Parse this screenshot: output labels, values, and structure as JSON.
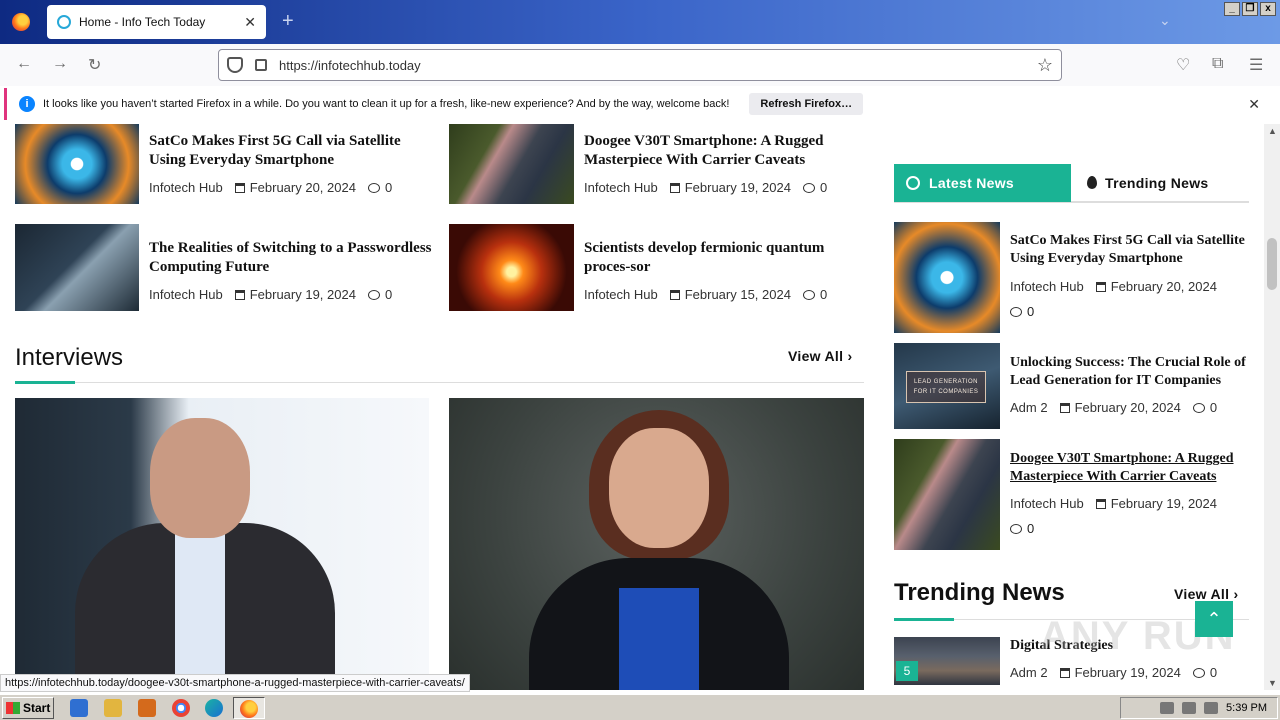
{
  "browser": {
    "tab_title": "Home - Info Tech Today",
    "url": "https://infotechhub.today",
    "notification": "It looks like you haven’t started Firefox in a while. Do you want to clean it up for a fresh, like-new experience? And by the way, welcome back!",
    "refresh_button": "Refresh Firefox…",
    "status_url": "https://infotechhub.today/doogee-v30t-smartphone-a-rugged-masterpiece-with-carrier-caveats/"
  },
  "main_cards": [
    {
      "title": "SatCo Makes First 5G Call via Satellite Using Everyday Smartphone",
      "author": "Infotech Hub",
      "date": "February 20, 2024",
      "comments": "0"
    },
    {
      "title": "Doogee V30T Smartphone: A Rugged Masterpiece With Carrier Caveats",
      "author": "Infotech Hub",
      "date": "February 19, 2024",
      "comments": "0"
    },
    {
      "title": "The Realities of Switching to a Passwordless Computing Future",
      "author": "Infotech Hub",
      "date": "February 19, 2024",
      "comments": "0"
    },
    {
      "title": "Scientists develop fermionic quantum proces-sor",
      "author": "Infotech Hub",
      "date": "February 15, 2024",
      "comments": "0"
    }
  ],
  "interviews": {
    "title": "Interviews",
    "view_all": "View All"
  },
  "sidebar": {
    "tabs": [
      "Latest News",
      "Trending News"
    ],
    "items": [
      {
        "title": "SatCo Makes First 5G Call via Satellite Using Everyday Smartphone",
        "author": "Infotech Hub",
        "date": "February 20, 2024",
        "comments": "0"
      },
      {
        "title": "Unlocking Success: The Crucial Role of Lead Generation for IT Companies",
        "author": "Adm 2",
        "date": "February 20, 2024",
        "comments": "0",
        "image_text": "LEAD GENERATION FOR IT COMPANIES"
      },
      {
        "title": "Doogee V30T Smartphone: A Rugged Masterpiece With Carrier Caveats",
        "author": "Infotech Hub",
        "date": "February 19, 2024",
        "comments": "0"
      }
    ],
    "trending_title": "Trending News",
    "trending_view_all": "View All",
    "trending_item": {
      "rank": "5",
      "title": "Digital Strategies",
      "author": "Adm 2",
      "date": "February 19, 2024",
      "comments": "0"
    }
  },
  "taskbar": {
    "start": "Start",
    "clock": "5:39 PM"
  },
  "watermark": "ANY RUN"
}
